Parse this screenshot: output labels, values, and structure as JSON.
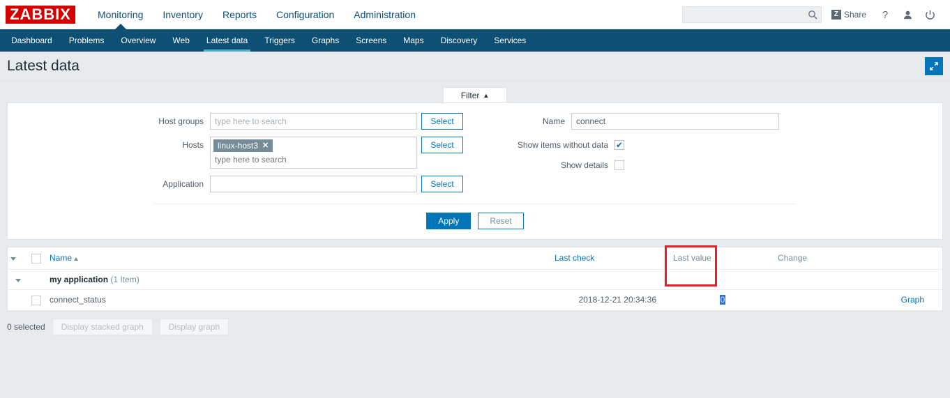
{
  "brand": {
    "logo_text": "ZABBIX"
  },
  "main_menu": {
    "items": [
      {
        "label": "Monitoring",
        "selected": true
      },
      {
        "label": "Inventory",
        "selected": false
      },
      {
        "label": "Reports",
        "selected": false
      },
      {
        "label": "Configuration",
        "selected": false
      },
      {
        "label": "Administration",
        "selected": false
      }
    ]
  },
  "top_right": {
    "search_value": "",
    "search_placeholder": "",
    "search_icon": "search-icon",
    "share_badge": "Z",
    "share_label": "Share",
    "help_icon": "?",
    "user_icon": "user-icon",
    "signout_icon": "power-icon"
  },
  "sub_menu": {
    "items": [
      {
        "label": "Dashboard",
        "selected": false
      },
      {
        "label": "Problems",
        "selected": false
      },
      {
        "label": "Overview",
        "selected": false
      },
      {
        "label": "Web",
        "selected": false
      },
      {
        "label": "Latest data",
        "selected": true
      },
      {
        "label": "Triggers",
        "selected": false
      },
      {
        "label": "Graphs",
        "selected": false
      },
      {
        "label": "Screens",
        "selected": false
      },
      {
        "label": "Maps",
        "selected": false
      },
      {
        "label": "Discovery",
        "selected": false
      },
      {
        "label": "Services",
        "selected": false
      }
    ]
  },
  "page": {
    "title": "Latest data",
    "kiosk_icon": "expand-arrows-icon"
  },
  "filter": {
    "tab_label": "Filter",
    "tab_arrow": "▲",
    "host_groups": {
      "label": "Host groups",
      "value": "",
      "placeholder": "type here to search",
      "select_label": "Select"
    },
    "hosts": {
      "label": "Hosts",
      "chips": [
        {
          "text": "linux-host3",
          "remove": "✕"
        }
      ],
      "placeholder": "type here to search",
      "select_label": "Select"
    },
    "application": {
      "label": "Application",
      "value": "",
      "placeholder": "",
      "select_label": "Select"
    },
    "name": {
      "label": "Name",
      "value": "connect",
      "placeholder": ""
    },
    "show_items_without_data": {
      "label": "Show items without data",
      "checked": true,
      "tick": "✔"
    },
    "show_details": {
      "label": "Show details",
      "checked": false,
      "tick": ""
    },
    "apply_label": "Apply",
    "reset_label": "Reset"
  },
  "table": {
    "headers": {
      "name": "Name",
      "name_sort": "asc",
      "last_check": "Last check",
      "last_value": "Last value",
      "change": "Change"
    },
    "group_row": {
      "name": "my application",
      "count": "(1 Item)"
    },
    "rows": [
      {
        "name": "connect_status",
        "last_check": "2018-12-21 20:34:36",
        "last_value": "0",
        "value_selected": true,
        "change": "",
        "graph_label": "Graph"
      }
    ]
  },
  "footer": {
    "selected_text": "0 selected",
    "display_stacked_graph": "Display stacked graph",
    "display_graph": "Display graph"
  },
  "annotation": {
    "highlight_color": "#ee1c25",
    "target": "last-value-cell"
  }
}
